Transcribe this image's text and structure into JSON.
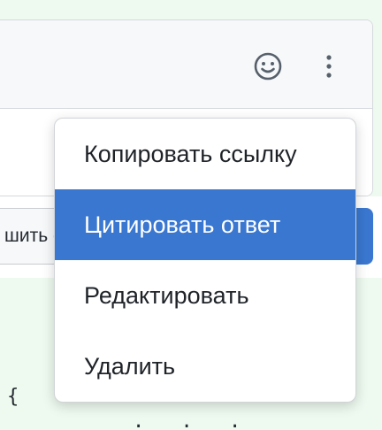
{
  "colors": {
    "accent": "#3a77d0",
    "page_background": "#eefaf0",
    "card_header_background": "#f6f8fa"
  },
  "header": {
    "reaction_icon": "smiley-face-icon",
    "more_icon": "kebab-vertical-icon"
  },
  "reply_bar": {
    "reply_label": "шить с"
  },
  "code": {
    "brace": "{",
    "tail": "·   ·  ·"
  },
  "context_menu": {
    "items": [
      {
        "label": "Копировать ссылку",
        "active": false
      },
      {
        "label": "Цитировать ответ",
        "active": true
      },
      {
        "label": "Редактировать",
        "active": false
      },
      {
        "label": "Удалить",
        "active": false
      }
    ]
  }
}
